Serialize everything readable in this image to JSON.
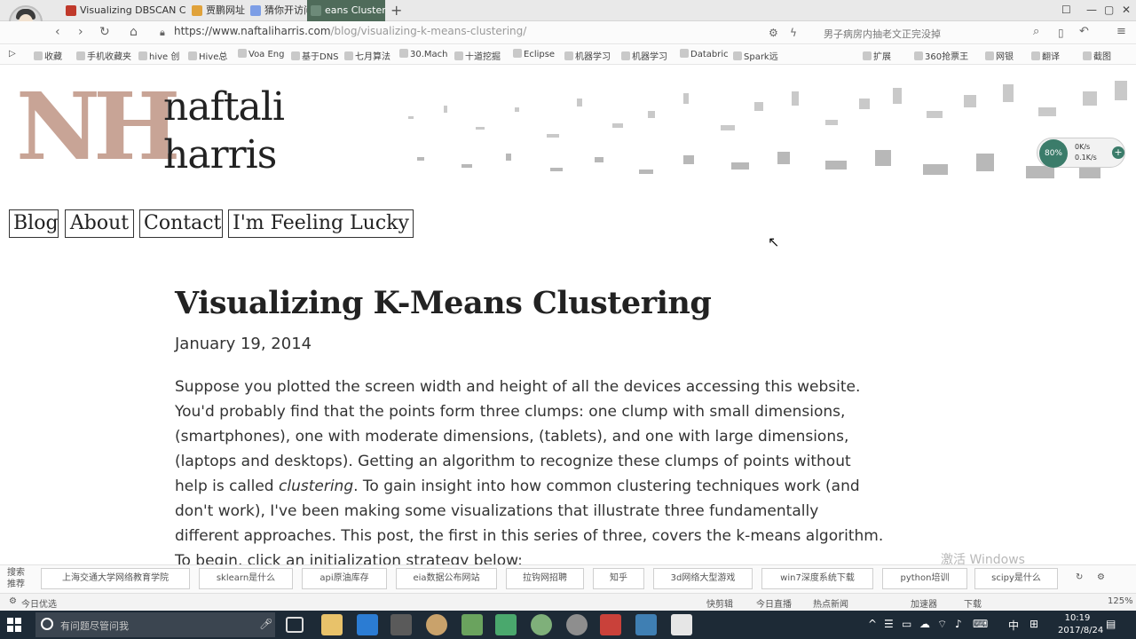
{
  "browser": {
    "tabs": [
      {
        "label": "Visualizing DBSCAN Cluste",
        "active": false,
        "color": "#c0392b"
      },
      {
        "label": "贾鹏网址",
        "active": false,
        "color": "#e0a23a"
      },
      {
        "label": "猜你开访问",
        "active": false,
        "color": "#7d9ee6"
      },
      {
        "label": "eans Clusterin",
        "active": true,
        "color": "#6d8a79"
      }
    ],
    "new_tab": "+",
    "url_host": "https://www.naftaliharris.com",
    "url_path": "/blog/visualizing-k-means-clustering/",
    "search_hint": "男子病房内抽老文正完没掉",
    "bookmarks": [
      "收藏",
      "手机收藏夹",
      "hive 创",
      "Hive总",
      "Voa Eng",
      "基于DNS",
      "七月算法",
      "30.Mach",
      "十道挖掘",
      "Eclipse",
      "机器学习",
      "机器学习",
      "Databric",
      "Spark远"
    ],
    "bookmarks_right": [
      "扩展",
      "360抢票王",
      "网银",
      "翻译",
      "截图"
    ]
  },
  "site": {
    "logo_initials": "NH",
    "logo_first": "naftali",
    "logo_last": "harris",
    "nav": [
      "Blog",
      "About",
      "Contact",
      "I'm Feeling Lucky"
    ],
    "logo_color": "#c8a496"
  },
  "widget": {
    "percent": "80%",
    "down": "0K/s",
    "up": "0.1K/s"
  },
  "article": {
    "title": "Visualizing K-Means Clustering",
    "date": "January 19, 2014",
    "para_before_em": "Suppose you plotted the screen width and height of all the devices accessing this website. You'd probably find that the points form three clumps: one clump with small dimensions, (smartphones), one with moderate dimensions, (tablets), and one with large dimensions, (laptops and desktops). Getting an algorithm to recognize these clumps of points without help is called ",
    "para_em": "clustering",
    "para_after_em": ". To gain insight into how common clustering techniques work (and don't work), I've been making some visualizations that illustrate three fundamentally different approaches. This post, the first in this series of three, covers the k-means algorithm. To begin, click an initialization strategy below:"
  },
  "hotbar": {
    "label": "搜索推荐",
    "items": [
      "上海交通大学网络教育学院",
      "sklearn是什么",
      "api原油库存",
      "eia数据公布网站",
      "拉钩网招聘",
      "知乎",
      "3d网络大型游戏",
      "win7深度系统下载",
      "python培训",
      "scipy是什么"
    ]
  },
  "statusbar": {
    "left": "今日优选",
    "items": [
      "快剪辑",
      "今日直播",
      "热点新闻",
      "加速器",
      "下载",
      "125%"
    ]
  },
  "watermark": "激活 Windows",
  "taskbar": {
    "search_placeholder": "有问题尽管问我",
    "ime": "中",
    "time": "10:19",
    "date": "2017/8/24"
  }
}
